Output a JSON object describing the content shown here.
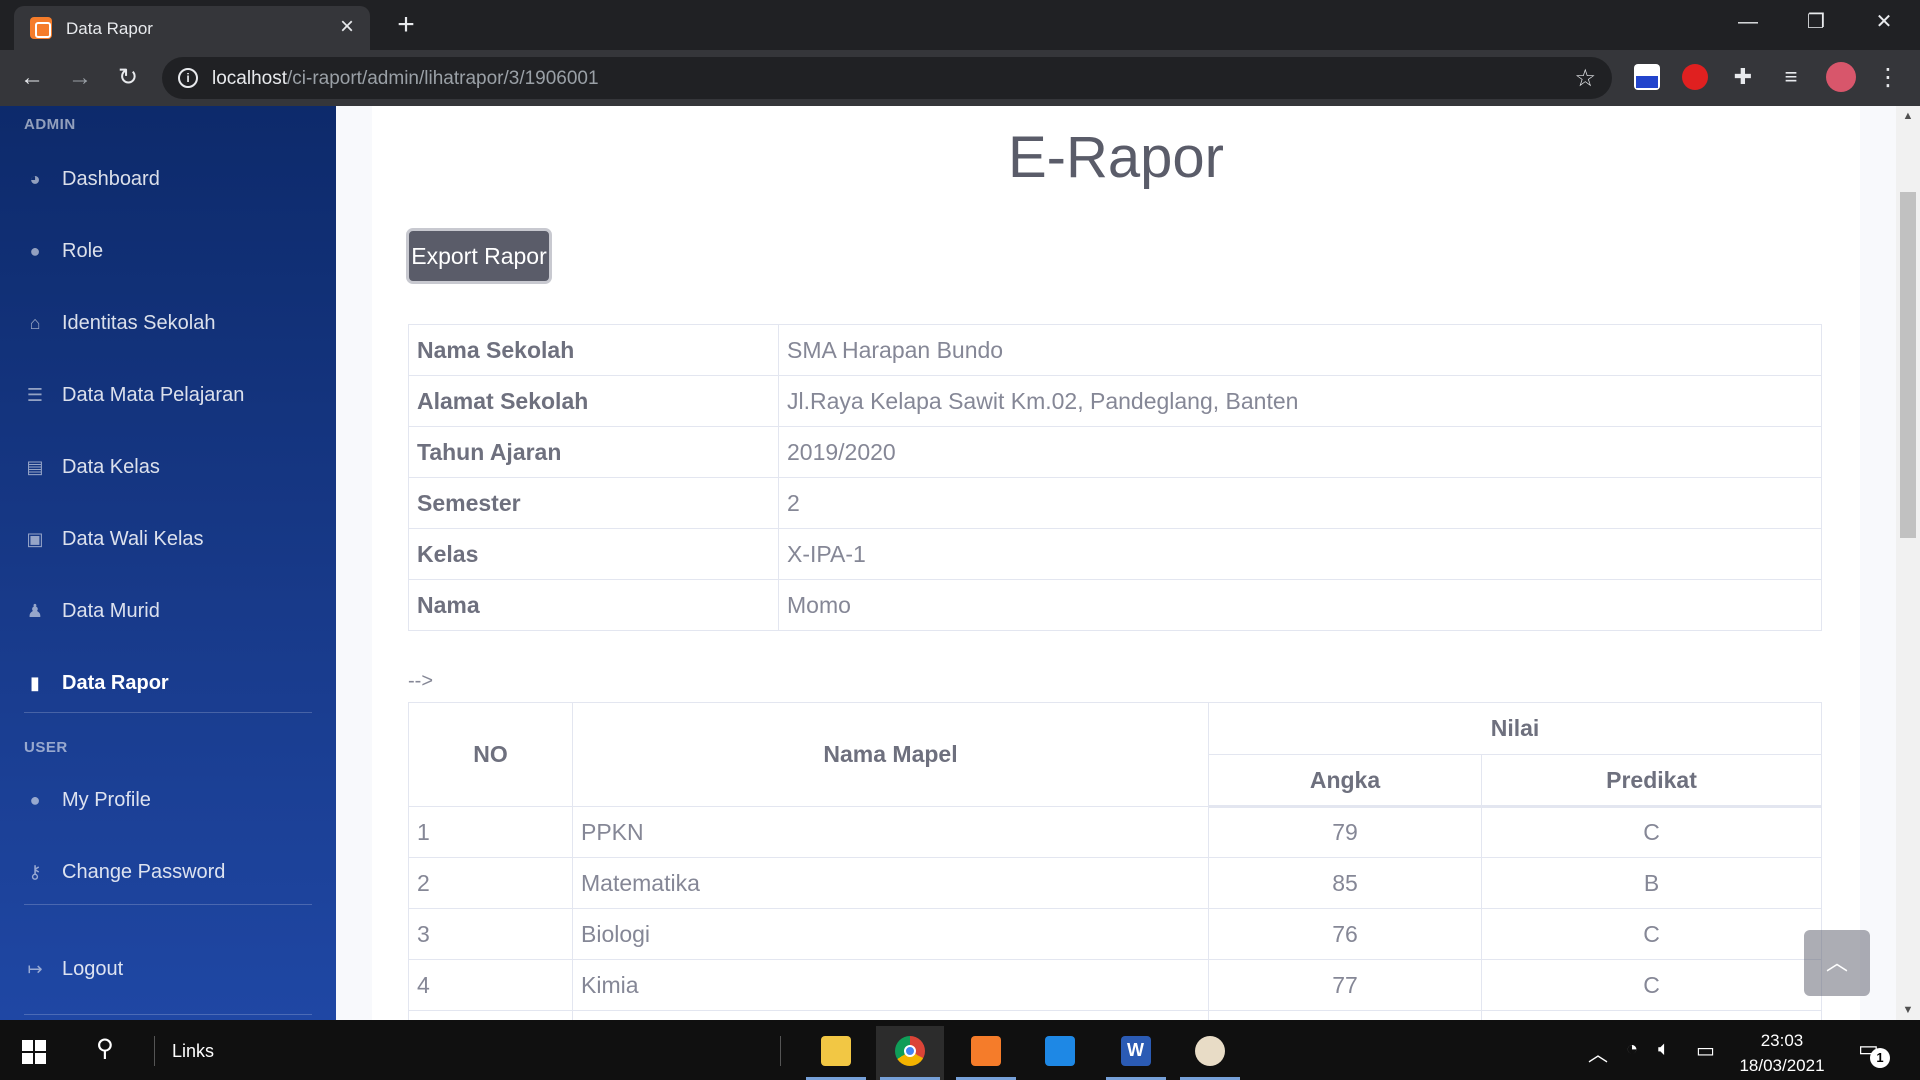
{
  "browser": {
    "tab_title": "Data Rapor",
    "url_host": "localhost",
    "url_path": "/ci-raport/admin/lihatrapor/3/1906001"
  },
  "sidebar": {
    "heading_admin": "ADMIN",
    "heading_user": "USER",
    "items": [
      {
        "label": "Dashboard",
        "icon": "tachometer-icon"
      },
      {
        "label": "Role",
        "icon": "user-cog-icon"
      },
      {
        "label": "Identitas Sekolah",
        "icon": "school-icon"
      },
      {
        "label": "Data Mata Pelajaran",
        "icon": "list-icon"
      },
      {
        "label": "Data Kelas",
        "icon": "table-list-icon"
      },
      {
        "label": "Data Wali Kelas",
        "icon": "chalkboard-teacher-icon"
      },
      {
        "label": "Data Murid",
        "icon": "user-graduate-icon"
      },
      {
        "label": "Data Rapor",
        "icon": "book-icon",
        "active": true
      }
    ],
    "user_items": [
      {
        "label": "My Profile",
        "icon": "user-icon"
      },
      {
        "label": "Change Password",
        "icon": "key-icon"
      }
    ],
    "logout_label": "Logout"
  },
  "main": {
    "title": "E-Rapor",
    "export_button": "Export Rapor",
    "info": [
      {
        "label": "Nama Sekolah",
        "value": "SMA Harapan Bundo"
      },
      {
        "label": "Alamat Sekolah",
        "value": "Jl.Raya Kelapa Sawit Km.02, Pandeglang, Banten"
      },
      {
        "label": "Tahun Ajaran",
        "value": "2019/2020"
      },
      {
        "label": "Semester",
        "value": "2"
      },
      {
        "label": "Kelas",
        "value": "X-IPA-1"
      },
      {
        "label": "Nama",
        "value": "Momo"
      }
    ],
    "stray_comment": "-->",
    "grades": {
      "col_no": "NO",
      "col_mapel": "Nama Mapel",
      "col_nilai": "Nilai",
      "col_angka": "Angka",
      "col_predikat": "Predikat",
      "rows": [
        {
          "no": "1",
          "mapel": "PPKN",
          "angka": "79",
          "predikat": "C"
        },
        {
          "no": "2",
          "mapel": "Matematika",
          "angka": "85",
          "predikat": "B"
        },
        {
          "no": "3",
          "mapel": "Biologi",
          "angka": "76",
          "predikat": "C"
        },
        {
          "no": "4",
          "mapel": "Kimia",
          "angka": "77",
          "predikat": "C"
        }
      ]
    }
  },
  "taskbar": {
    "links_label": "Links",
    "time": "23:03",
    "date": "18/03/2021",
    "notification_count": "1"
  },
  "colors": {
    "sidebar_top": "#0d2a6b",
    "sidebar_bottom": "#1f47a4",
    "export_button": "#5a5c69"
  }
}
